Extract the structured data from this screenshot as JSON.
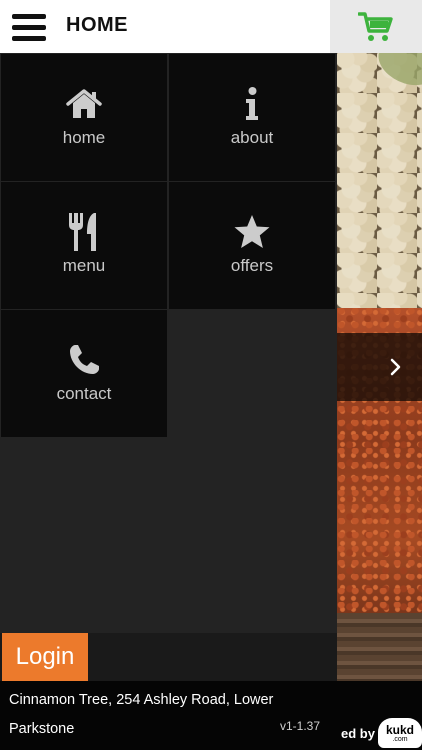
{
  "header": {
    "title": "HOME",
    "menu_icon": "hamburger-icon",
    "cart_icon": "cart-icon",
    "cart_color": "#3db33d"
  },
  "menu": {
    "items": [
      {
        "label": "home",
        "icon": "house-icon"
      },
      {
        "label": "about",
        "icon": "info-icon"
      },
      {
        "label": "menu",
        "icon": "fork-knife-icon"
      },
      {
        "label": "offers",
        "icon": "star-icon"
      },
      {
        "label": "contact",
        "icon": "phone-icon"
      }
    ],
    "tile_color": "#0b0b0b",
    "icon_color": "#cccccc"
  },
  "slider": {
    "next_icon": "chevron-right-icon"
  },
  "login": {
    "label": "Login",
    "color": "#ec7a2c"
  },
  "footer": {
    "address": "Cinnamon Tree, 254 Ashley Road, Lower Parkstone",
    "version": "v1-1.37",
    "powered_by": "ed by",
    "brand": "kukd",
    "brand_domain": ".com"
  }
}
